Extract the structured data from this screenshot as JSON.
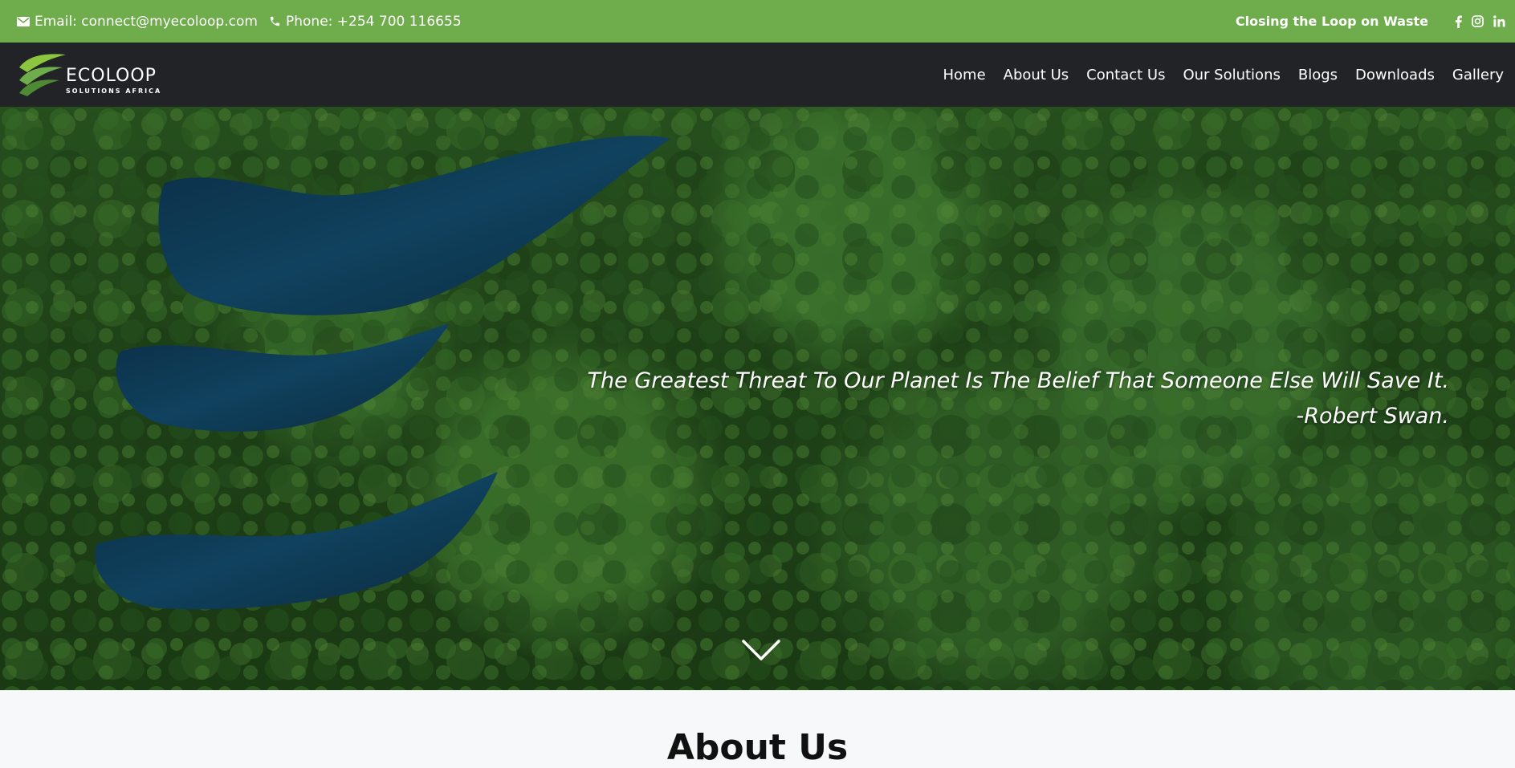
{
  "topbar": {
    "email_label": "Email: connect@myecoloop.com",
    "phone_label": "Phone: +254 700 116655",
    "tagline": "Closing the Loop on Waste",
    "social_icons": [
      "facebook-icon",
      "instagram-icon",
      "linkedin-icon"
    ],
    "background_color": "#6eac4c"
  },
  "brand": {
    "name": "ECOLOOP",
    "subtitle": "SOLUTIONS AFRICA"
  },
  "nav": {
    "items": [
      {
        "label": "Home"
      },
      {
        "label": "About Us"
      },
      {
        "label": "Contact Us"
      },
      {
        "label": "Our Solutions"
      },
      {
        "label": "Blogs"
      },
      {
        "label": "Downloads"
      },
      {
        "label": "Gallery"
      }
    ],
    "background_color": "#222326"
  },
  "hero": {
    "quote_line1": "The Greatest Threat To Our Planet Is The Belief That Someone Else Will Save It.",
    "quote_line2": "-Robert Swan.",
    "scroll_icon": "chevron-down-icon"
  },
  "about": {
    "heading": "About Us"
  }
}
